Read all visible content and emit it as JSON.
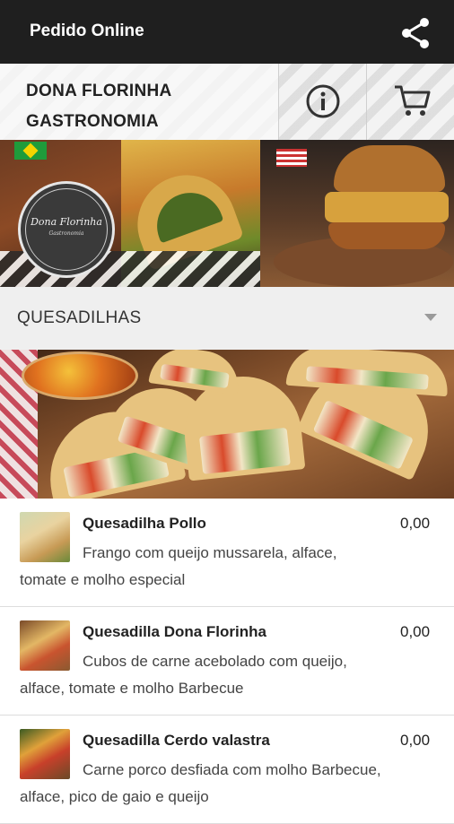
{
  "appbar": {
    "title": "Pedido Online",
    "share_icon": "share-icon"
  },
  "header": {
    "restaurant_name": "DONA FLORINHA\nGASTRONOMIA",
    "info_icon": "info-icon",
    "cart_icon": "cart-icon"
  },
  "banner": {
    "logo_text": "Dona Florinha",
    "logo_subtext": "Gastronomia"
  },
  "category": {
    "selected": "QUESADILHAS",
    "dropdown_icon": "caret-down-icon"
  },
  "items": [
    {
      "name": "Quesadilha Pollo",
      "price": "0,00",
      "description": "Frango com queijo mussarela, alface, tomate e molho especial"
    },
    {
      "name": "Quesadilla Dona Florinha",
      "price": "0,00",
      "description": "Cubos de carne acebolado com queijo, alface, tomate e molho Barbecue"
    },
    {
      "name": "Quesadilla Cerdo valastra",
      "price": "0,00",
      "description": "Carne porco desfiada com molho Barbecue, alface, pico de gaio e queijo"
    }
  ],
  "colors": {
    "appbar": "#1f1f1f",
    "category_bar": "#efefef",
    "text": "#222222"
  }
}
